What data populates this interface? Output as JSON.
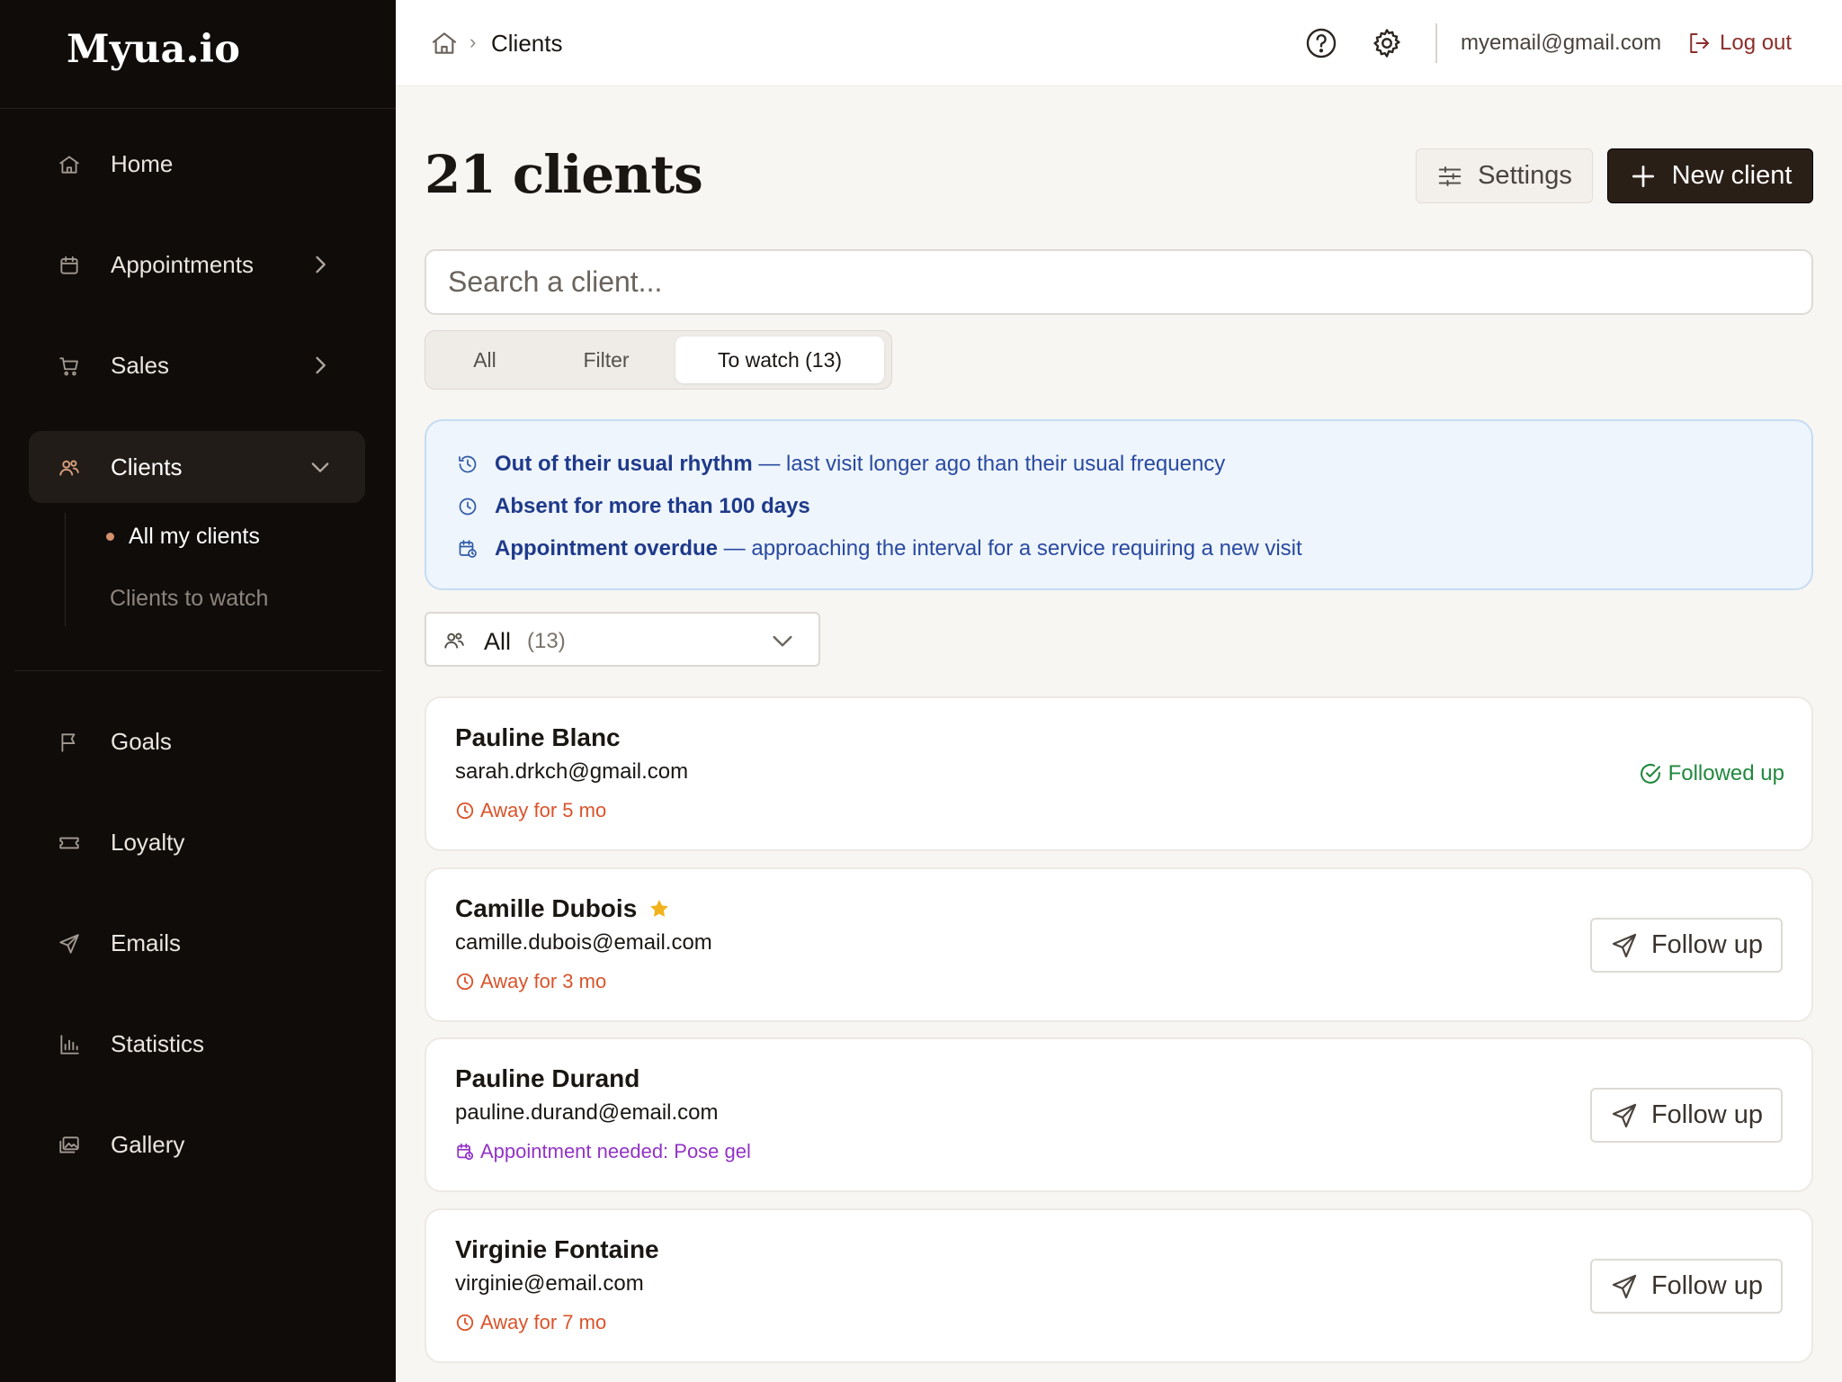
{
  "brand": "Myua.io",
  "sidebar": {
    "items": [
      {
        "label": "Home",
        "icon": "home-icon"
      },
      {
        "label": "Appointments",
        "icon": "calendar-icon"
      },
      {
        "label": "Sales",
        "icon": "cart-icon"
      },
      {
        "label": "Clients",
        "icon": "users-icon"
      },
      {
        "label": "Goals",
        "icon": "flag-icon"
      },
      {
        "label": "Loyalty",
        "icon": "ticket-icon"
      },
      {
        "label": "Emails",
        "icon": "send-icon"
      },
      {
        "label": "Statistics",
        "icon": "bar-chart-icon"
      },
      {
        "label": "Gallery",
        "icon": "gallery-icon"
      }
    ],
    "sub_items": [
      {
        "label": "All my clients"
      },
      {
        "label": "Clients to watch"
      }
    ]
  },
  "topbar": {
    "breadcrumb_current": "Clients",
    "breadcrumb_sep": "›",
    "user_email": "myemail@gmail.com",
    "logout_label": "Log out"
  },
  "page": {
    "title": "21 clients",
    "settings_label": "Settings",
    "new_client_label": "New client"
  },
  "search": {
    "placeholder": "Search a client..."
  },
  "tabs": [
    {
      "label": "All"
    },
    {
      "label": "Filter"
    },
    {
      "label": "To watch (13)"
    }
  ],
  "info": [
    {
      "strong": "Out of their usual rhythm",
      "rest": " — last visit longer ago than their usual frequency",
      "icon": "history-icon"
    },
    {
      "strong": "Absent for more than 100 days",
      "rest": "",
      "icon": "clock-icon"
    },
    {
      "strong": "Appointment overdue",
      "rest": " — approaching the interval for a service requiring a new visit",
      "icon": "calendar-clock-icon"
    }
  ],
  "group_select": {
    "label": "All",
    "count": "(13)"
  },
  "clients": [
    {
      "name": "Pauline Blanc",
      "email": "sarah.drkch@gmail.com",
      "status": "Away for 5 mo",
      "followed_label": "Followed up"
    },
    {
      "name": "Camille Dubois",
      "email": "camille.dubois@email.com",
      "status": "Away for 3 mo",
      "action_label": "Follow up"
    },
    {
      "name": "Pauline Durand",
      "email": "pauline.durand@email.com",
      "status": "Appointment needed: Pose gel",
      "action_label": "Follow up"
    },
    {
      "name": "Virginie Fontaine",
      "email": "virginie@email.com",
      "status": "Away for 7 mo",
      "action_label": "Follow up"
    }
  ],
  "colors": {
    "sidebar_bg": "#0f0c0a",
    "accent_dot": "#d4916b",
    "primary_button": "#2a1f17",
    "info_text": "#1f3a8a",
    "away": "#d9532b",
    "appointment": "#9233c8",
    "followed": "#22883e",
    "logout": "#8b2f2b",
    "star": "#f2b21b"
  }
}
